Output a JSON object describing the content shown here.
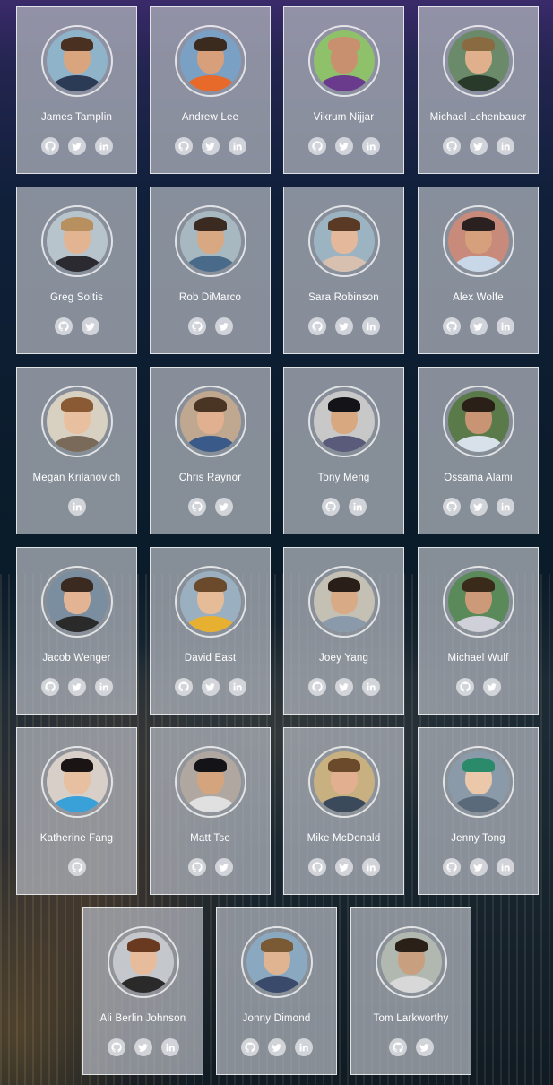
{
  "team": [
    {
      "name": "James Tamplin",
      "socials": [
        "github",
        "twitter",
        "linkedin"
      ],
      "skin": "#d9a57f",
      "hair": "#4a3020",
      "shirt": "#2b3a55",
      "bg": "#8fb3c8"
    },
    {
      "name": "Andrew Lee",
      "socials": [
        "github",
        "twitter",
        "linkedin"
      ],
      "skin": "#d8a07a",
      "hair": "#3b2a1e",
      "shirt": "#e86a2a",
      "bg": "#7aa0c4"
    },
    {
      "name": "Vikrum Nijjar",
      "socials": [
        "github",
        "twitter",
        "linkedin"
      ],
      "skin": "#c99070",
      "hair": "#c99070",
      "shirt": "#6a3b8c",
      "bg": "#8fc06a"
    },
    {
      "name": "Michael Lehenbauer",
      "socials": [
        "github",
        "twitter",
        "linkedin"
      ],
      "skin": "#e0b08c",
      "hair": "#8a6a40",
      "shirt": "#2a3a2a",
      "bg": "#6a8a6a"
    },
    {
      "name": "Greg Soltis",
      "socials": [
        "github",
        "twitter"
      ],
      "skin": "#e2b492",
      "hair": "#b89060",
      "shirt": "#2a2a30",
      "bg": "#b8c4cc"
    },
    {
      "name": "Rob DiMarco",
      "socials": [
        "github",
        "twitter"
      ],
      "skin": "#d8a882",
      "hair": "#3a2a20",
      "shirt": "#4a6a8a",
      "bg": "#a8b8c0"
    },
    {
      "name": "Sara Robinson",
      "socials": [
        "github",
        "twitter",
        "linkedin"
      ],
      "skin": "#e4b89a",
      "hair": "#5a3a24",
      "shirt": "#d8c0b0",
      "bg": "#9cb4c2"
    },
    {
      "name": "Alex Wolfe",
      "socials": [
        "github",
        "twitter",
        "linkedin"
      ],
      "skin": "#d6a07c",
      "hair": "#2a2020",
      "shirt": "#c8d8e8",
      "bg": "#c88a7a"
    },
    {
      "name": "Megan Krilanovich",
      "socials": [
        "linkedin"
      ],
      "skin": "#e8c0a0",
      "hair": "#8a5a34",
      "shirt": "#7a6a5a",
      "bg": "#d8d0c0"
    },
    {
      "name": "Chris Raynor",
      "socials": [
        "github",
        "twitter"
      ],
      "skin": "#e0b090",
      "hair": "#4a3424",
      "shirt": "#3a5a8a",
      "bg": "#c0a890"
    },
    {
      "name": "Tony Meng",
      "socials": [
        "github",
        "linkedin"
      ],
      "skin": "#d8a880",
      "hair": "#141418",
      "shirt": "#5a5a7a",
      "bg": "#c8c8c8"
    },
    {
      "name": "Ossama Alami",
      "socials": [
        "github",
        "twitter",
        "linkedin"
      ],
      "skin": "#c89474",
      "hair": "#2a2018",
      "shirt": "#d8e0ea",
      "bg": "#5a7a4a"
    },
    {
      "name": "Jacob Wenger",
      "socials": [
        "github",
        "twitter",
        "linkedin"
      ],
      "skin": "#e2b494",
      "hair": "#3a2a20",
      "shirt": "#2a2a2a",
      "bg": "#7a8ea0"
    },
    {
      "name": "David East",
      "socials": [
        "github",
        "twitter",
        "linkedin"
      ],
      "skin": "#e6bc98",
      "hair": "#6a4a2a",
      "shirt": "#e8b030",
      "bg": "#9ab0c0"
    },
    {
      "name": "Joey Yang",
      "socials": [
        "github",
        "twitter",
        "linkedin"
      ],
      "skin": "#d8aa86",
      "hair": "#2a1e18",
      "shirt": "#8a9aaa",
      "bg": "#c4c0b4"
    },
    {
      "name": "Michael Wulf",
      "socials": [
        "github",
        "twitter"
      ],
      "skin": "#cc9a78",
      "hair": "#3a2a1a",
      "shirt": "#d0d0d8",
      "bg": "#5a8a5a"
    },
    {
      "name": "Katherine Fang",
      "socials": [
        "github"
      ],
      "skin": "#e6c0a0",
      "hair": "#1a1414",
      "shirt": "#3aa0d8",
      "bg": "#d8d0c8"
    },
    {
      "name": "Matt Tse",
      "socials": [
        "github",
        "twitter"
      ],
      "skin": "#d4a47e",
      "hair": "#141418",
      "shirt": "#e0e0e0",
      "bg": "#b0a8a0"
    },
    {
      "name": "Mike McDonald",
      "socials": [
        "github",
        "twitter",
        "linkedin"
      ],
      "skin": "#e2b090",
      "hair": "#6a4a2a",
      "shirt": "#3a4a5a",
      "bg": "#c8b080"
    },
    {
      "name": "Jenny Tong",
      "socials": [
        "github",
        "twitter",
        "linkedin"
      ],
      "skin": "#ecc8aa",
      "hair": "#2a8a6a",
      "shirt": "#5a6a7a",
      "bg": "#8a9aa8"
    },
    {
      "name": "Ali Berlin Johnson",
      "socials": [
        "github",
        "twitter",
        "linkedin"
      ],
      "skin": "#e6bc9c",
      "hair": "#6a3a20",
      "shirt": "#2a2a2a",
      "bg": "#c4c8cc"
    },
    {
      "name": "Jonny Dimond",
      "socials": [
        "github",
        "twitter",
        "linkedin"
      ],
      "skin": "#e0b490",
      "hair": "#7a5a34",
      "shirt": "#3a4a6a",
      "bg": "#8aa8c0"
    },
    {
      "name": "Tom Larkworthy",
      "socials": [
        "github",
        "twitter"
      ],
      "skin": "#c8a080",
      "hair": "#2a2018",
      "shirt": "#d8d8d8",
      "bg": "#b0b8b0"
    }
  ]
}
